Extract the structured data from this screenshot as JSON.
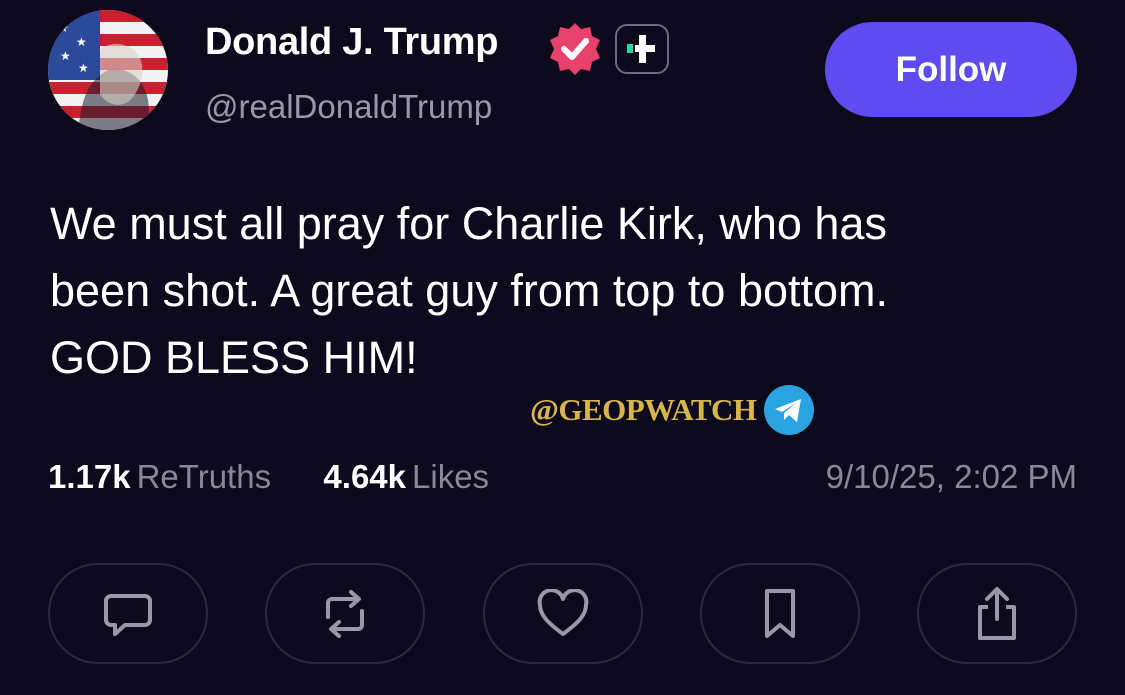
{
  "post": {
    "author": {
      "display_name": "Donald J. Trump",
      "handle": "@realDonaldTrump",
      "verified_icon": "verified-badge-icon",
      "badge_icon": "plus-badge-icon"
    },
    "follow_label": "Follow",
    "text_lines": [
      "We must all pray for Charlie Kirk, who has",
      "been shot. A great guy from top to bottom.",
      "GOD BLESS HIM!"
    ],
    "watermark": {
      "text": "@GEOPWATCH",
      "icon": "telegram-icon"
    },
    "stats": {
      "retruths_count": "1.17k",
      "retruths_label": "ReTruths",
      "likes_count": "4.64k",
      "likes_label": "Likes"
    },
    "timestamp": "9/10/25, 2:02 PM"
  },
  "actions": [
    {
      "name": "reply",
      "icon": "comment-icon"
    },
    {
      "name": "retruth",
      "icon": "repost-icon"
    },
    {
      "name": "like",
      "icon": "heart-icon"
    },
    {
      "name": "bookmark",
      "icon": "bookmark-icon"
    },
    {
      "name": "share",
      "icon": "share-icon"
    }
  ],
  "colors": {
    "background": "#0c0a1c",
    "follow_button": "#5f4bf0",
    "verified_badge": "#e8416b",
    "muted_text": "#8a8898",
    "watermark_text": "#d7b54a",
    "telegram_blue": "#2aa3e0"
  }
}
